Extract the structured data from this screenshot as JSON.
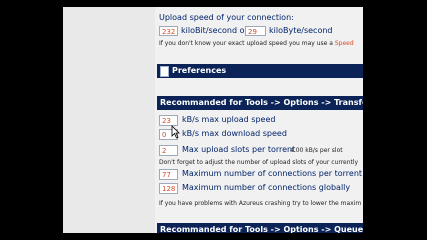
{
  "upload": {
    "heading": "Upload speed of your connection:",
    "kbit_value": "232",
    "kbit_unit": "kiloBit/second or",
    "kbyte_value": "29",
    "kbyte_unit": "kiloByte/second",
    "hint": "If you don't know your exact upload speed you may use a",
    "hint_link": "Speed"
  },
  "preferences": {
    "title": "Preferences"
  },
  "transfer": {
    "title": "Recommanded for Tools -> Options -> Transfer",
    "max_upload_value": "23",
    "max_upload_label": "kB/s max upload speed",
    "max_download_value": "0",
    "max_download_label": "kB/s max download speed",
    "slots_value": "2",
    "slots_label": "Max upload slots per torrent",
    "slots_note": "4.00 kB/s per slot",
    "reminder": "Don't forget to adjust the number of upload slots of your currently",
    "conn_torrent_value": "77",
    "conn_torrent_label": "Maximum number of connections per torrent",
    "conn_global_value": "128",
    "conn_global_label": "Maximum number of connections globally",
    "crash_note": "If you have problems with Azureus crashing try to lower the maxim"
  },
  "queue": {
    "title": "Recommanded for Tools -> Options -> Queue"
  }
}
